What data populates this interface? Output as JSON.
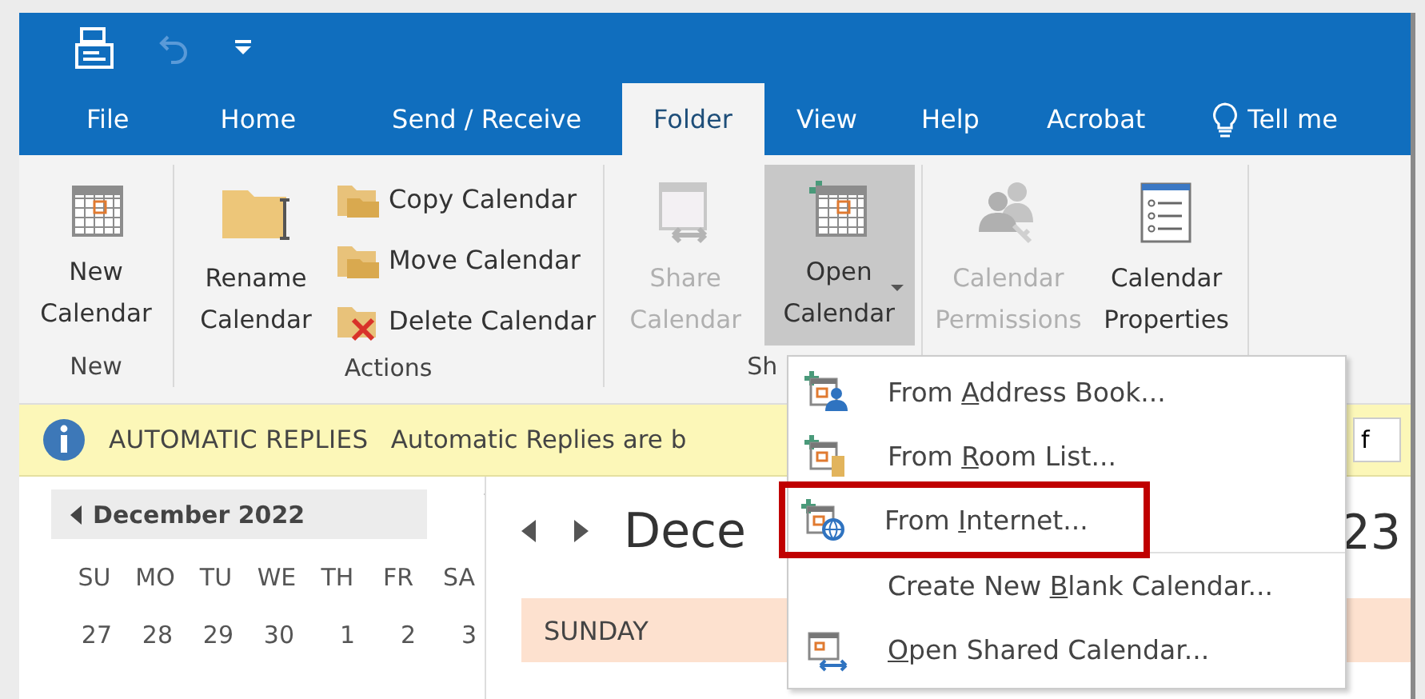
{
  "quick_access": [
    {
      "kind": "mail"
    },
    {
      "kind": "undo",
      "disabled": true
    },
    {
      "kind": "customize"
    }
  ],
  "tabs": [
    {
      "label": "File",
      "selected": false
    },
    {
      "label": "Home",
      "selected": false
    },
    {
      "label": "Send / Receive",
      "selected": false
    },
    {
      "label": "Folder",
      "selected": true
    },
    {
      "label": "View",
      "selected": false
    },
    {
      "label": "Help",
      "selected": false
    },
    {
      "label": "Acrobat",
      "selected": false
    },
    {
      "label": "Tell me",
      "selected": false,
      "kind": "search"
    }
  ],
  "ribbon": {
    "groups": [
      {
        "label": "New",
        "large_buttons": [
          {
            "kind": "new-calendar",
            "label": "New Calendar",
            "disabled": false,
            "expanded": false
          }
        ]
      },
      {
        "label": "Actions",
        "large_buttons": [
          {
            "kind": "rename",
            "label": "Rename Calendar",
            "disabled": false,
            "expanded": false
          }
        ],
        "small_buttons": [
          {
            "kind": "copy",
            "label": "Copy Calendar"
          },
          {
            "kind": "move",
            "label": "Move Calendar"
          },
          {
            "kind": "delete",
            "label": "Delete Calendar"
          }
        ]
      },
      {
        "label": "Sh",
        "large_buttons": [
          {
            "kind": "share",
            "label": "Share Calendar",
            "disabled": true,
            "expanded": false
          },
          {
            "kind": "open",
            "label": "Open Calendar",
            "disabled": false,
            "expanded": true,
            "dropdown": true
          }
        ]
      },
      {
        "large_buttons": [
          {
            "kind": "permissions",
            "label": "Calendar Permissions",
            "disabled": true,
            "expanded": false
          },
          {
            "kind": "properties",
            "label": "Calendar Properties",
            "disabled": false,
            "expanded": false
          }
        ]
      }
    ]
  },
  "info_bar": {
    "title": "AUTOMATIC REPLIES",
    "message": "Automatic Replies are b",
    "field_value": "f"
  },
  "mini_calendar": {
    "month": "December 2022",
    "weekdays": [
      "SU",
      "MO",
      "TU",
      "WE",
      "TH",
      "FR",
      "SA"
    ],
    "weeks": [
      [
        "27",
        "28",
        "29",
        "30",
        "1",
        "2",
        "3"
      ]
    ]
  },
  "calendar_view": {
    "title": "Dece",
    "title_end": "23",
    "day_header": "SUNDAY"
  },
  "open_calendar_menu": [
    {
      "kind": "address-book",
      "before": "From ",
      "key": "A",
      "after": "ddress Book...",
      "highlighted": false
    },
    {
      "kind": "room-list",
      "before": "From ",
      "key": "R",
      "after": "oom List...",
      "highlighted": false
    },
    {
      "kind": "internet",
      "before": "From ",
      "key": "I",
      "after": "nternet...",
      "highlighted": true
    },
    {
      "kind": "blank",
      "before": "Create New ",
      "key": "B",
      "after": "lank Calendar...",
      "highlighted": false
    },
    {
      "kind": "shared",
      "key": "O",
      "after": "pen Shared Calendar...",
      "highlighted": false
    }
  ]
}
